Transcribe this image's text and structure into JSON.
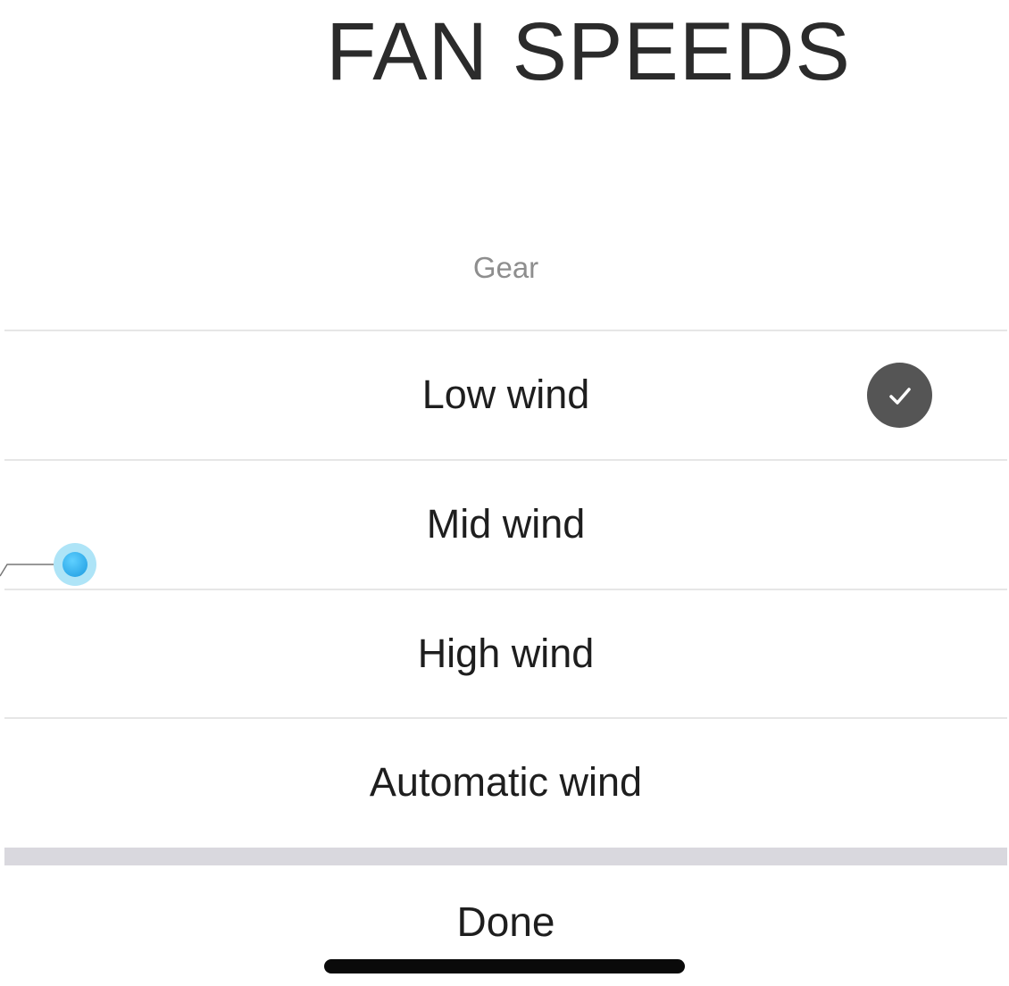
{
  "title": "FAN SPEEDS",
  "sheet": {
    "header": "Gear",
    "options": [
      {
        "label": "Low wind",
        "selected": true
      },
      {
        "label": "Mid wind",
        "selected": false
      },
      {
        "label": "High wind",
        "selected": false
      },
      {
        "label": "Automatic wind",
        "selected": false
      }
    ],
    "done_label": "Done"
  },
  "icons": {
    "selected": "checkmark-circle-icon"
  },
  "colors": {
    "check_bg": "#555555",
    "touch_indicator": "#1b9ae0",
    "separator_band": "#d9d8de"
  }
}
